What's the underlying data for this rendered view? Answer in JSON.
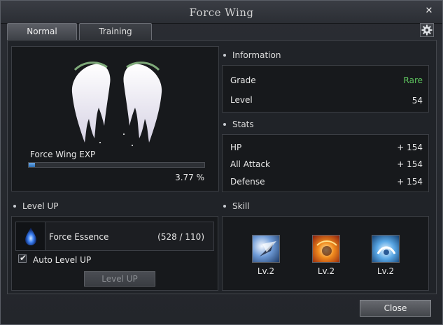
{
  "window": {
    "title": "Force Wing"
  },
  "tabs": [
    {
      "label": "Normal",
      "active": true
    },
    {
      "label": "Training",
      "active": false
    }
  ],
  "wing": {
    "exp_label": "Force Wing EXP",
    "exp_percent_text": "3.77 %",
    "exp_fraction": 0.0377
  },
  "information": {
    "heading": "Information",
    "grade_label": "Grade",
    "grade_value": "Rare",
    "level_label": "Level",
    "level_value": "54",
    "grade_color": "#5fc65f"
  },
  "stats": {
    "heading": "Stats",
    "items": [
      {
        "label": "HP",
        "value": "+ 154"
      },
      {
        "label": "All Attack",
        "value": "+ 154"
      },
      {
        "label": "Defense",
        "value": "+ 154"
      }
    ]
  },
  "level_up": {
    "heading": "Level UP",
    "essence_label": "Force Essence",
    "essence_count": "(528 / 110)",
    "auto_label": "Auto Level UP",
    "auto_checked": true,
    "button_label": "Level UP",
    "button_enabled": false
  },
  "skill": {
    "heading": "Skill",
    "items": [
      {
        "icon": "wing-kick-skill-icon",
        "level": "Lv.2"
      },
      {
        "icon": "fire-burst-skill-icon",
        "level": "Lv.2"
      },
      {
        "icon": "ice-wave-skill-icon",
        "level": "Lv.2"
      }
    ]
  },
  "footer": {
    "close_label": "Close"
  }
}
